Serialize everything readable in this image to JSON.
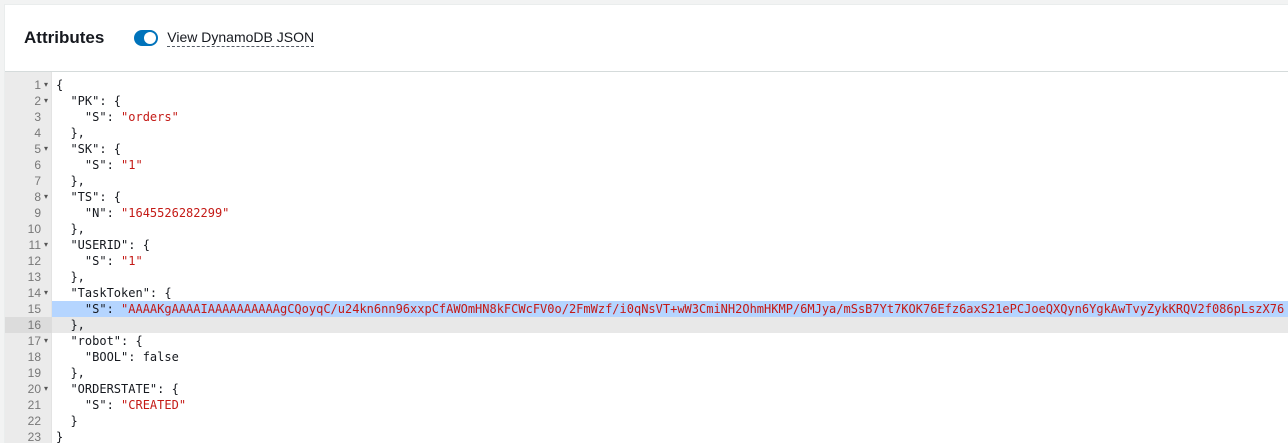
{
  "header": {
    "title": "Attributes",
    "toggle_label": "View DynamoDB JSON",
    "toggle_on": true
  },
  "editor": {
    "lines": [
      {
        "n": "1",
        "fold": true,
        "segments": [
          {
            "t": "{",
            "c": "p"
          }
        ]
      },
      {
        "n": "2",
        "fold": true,
        "segments": [
          {
            "t": "  \"PK\": {",
            "c": "p"
          }
        ]
      },
      {
        "n": "3",
        "fold": false,
        "segments": [
          {
            "t": "    \"S\": ",
            "c": "p"
          },
          {
            "t": "\"orders\"",
            "c": "s"
          }
        ]
      },
      {
        "n": "4",
        "fold": false,
        "segments": [
          {
            "t": "  },",
            "c": "p"
          }
        ]
      },
      {
        "n": "5",
        "fold": true,
        "segments": [
          {
            "t": "  \"SK\": {",
            "c": "p"
          }
        ]
      },
      {
        "n": "6",
        "fold": false,
        "segments": [
          {
            "t": "    \"S\": ",
            "c": "p"
          },
          {
            "t": "\"1\"",
            "c": "s"
          }
        ]
      },
      {
        "n": "7",
        "fold": false,
        "segments": [
          {
            "t": "  },",
            "c": "p"
          }
        ]
      },
      {
        "n": "8",
        "fold": true,
        "segments": [
          {
            "t": "  \"TS\": {",
            "c": "p"
          }
        ]
      },
      {
        "n": "9",
        "fold": false,
        "segments": [
          {
            "t": "    \"N\": ",
            "c": "p"
          },
          {
            "t": "\"1645526282299\"",
            "c": "s"
          }
        ]
      },
      {
        "n": "10",
        "fold": false,
        "segments": [
          {
            "t": "  },",
            "c": "p"
          }
        ]
      },
      {
        "n": "11",
        "fold": true,
        "segments": [
          {
            "t": "  \"USERID\": {",
            "c": "p"
          }
        ]
      },
      {
        "n": "12",
        "fold": false,
        "segments": [
          {
            "t": "    \"S\": ",
            "c": "p"
          },
          {
            "t": "\"1\"",
            "c": "s"
          }
        ]
      },
      {
        "n": "13",
        "fold": false,
        "segments": [
          {
            "t": "  },",
            "c": "p"
          }
        ]
      },
      {
        "n": "14",
        "fold": true,
        "segments": [
          {
            "t": "  \"TaskToken\": {",
            "c": "p"
          }
        ]
      },
      {
        "n": "15",
        "fold": false,
        "selected": true,
        "segments": [
          {
            "t": "    \"S\": ",
            "c": "p"
          },
          {
            "t": "\"AAAAKgAAAAIAAAAAAAAAAgCQoyqC/u24kn6nn96xxpCfAWOmHN8kFCWcFV0o/2FmWzf/i0qNsVT+wW3CmiNH2OhmHKMP/6MJya/mSsB7Yt7KOK76Efz6axS21ePCJoeQXQyn6YgkAwTvyZykKRQV2f086pLszX76",
            "c": "s"
          }
        ]
      },
      {
        "n": "16",
        "fold": false,
        "active": true,
        "segments": [
          {
            "t": "  },",
            "c": "p"
          }
        ]
      },
      {
        "n": "17",
        "fold": true,
        "segments": [
          {
            "t": "  \"robot\": {",
            "c": "p"
          }
        ]
      },
      {
        "n": "18",
        "fold": false,
        "segments": [
          {
            "t": "    \"BOOL\": false",
            "c": "p"
          }
        ]
      },
      {
        "n": "19",
        "fold": false,
        "segments": [
          {
            "t": "  },",
            "c": "p"
          }
        ]
      },
      {
        "n": "20",
        "fold": true,
        "segments": [
          {
            "t": "  \"ORDERSTATE\": {",
            "c": "p"
          }
        ]
      },
      {
        "n": "21",
        "fold": false,
        "segments": [
          {
            "t": "    \"S\": ",
            "c": "p"
          },
          {
            "t": "\"CREATED\"",
            "c": "s"
          }
        ]
      },
      {
        "n": "22",
        "fold": false,
        "segments": [
          {
            "t": "  }",
            "c": "p"
          }
        ]
      },
      {
        "n": "23",
        "fold": false,
        "segments": [
          {
            "t": "}",
            "c": "p"
          }
        ]
      }
    ]
  },
  "colors": {
    "toggle": "#0073bb",
    "string": "#c41a16",
    "selection": "#b5d5ff"
  },
  "icons": {
    "fold": "caret-down-icon"
  }
}
